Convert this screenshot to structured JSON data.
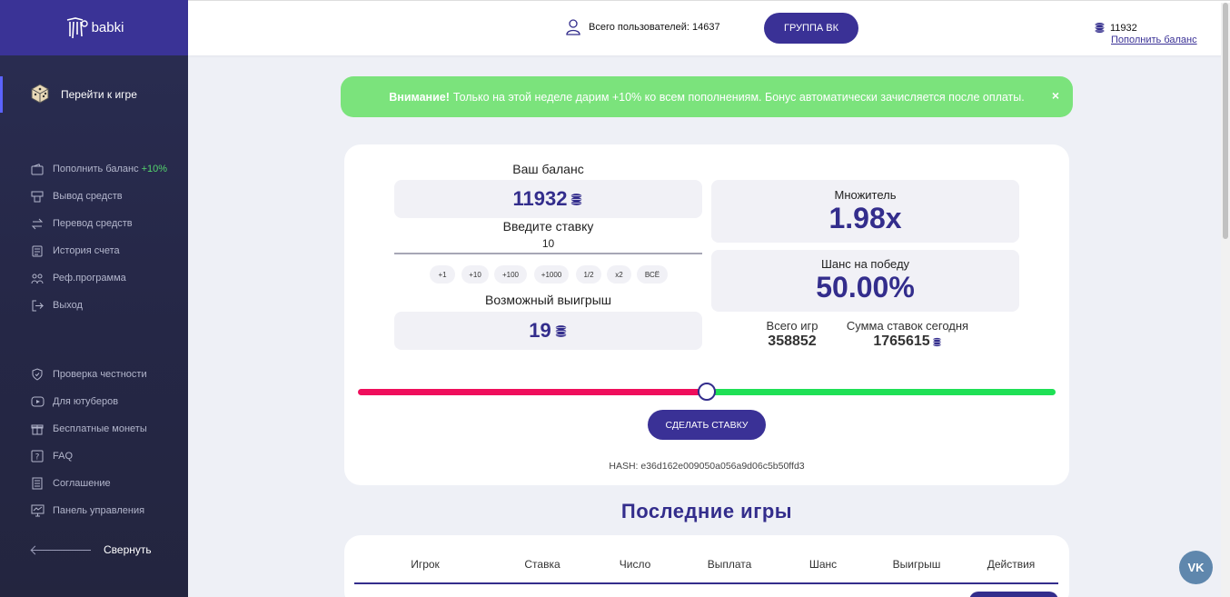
{
  "app": {
    "logo_text": "babki"
  },
  "sidebar": {
    "play_label": "Перейти к игре",
    "menu1": [
      {
        "label": "Пополнить баланс",
        "bonus": "+10%",
        "icon": "wallet-icon"
      },
      {
        "label": "Вывод средств",
        "icon": "atm-icon"
      },
      {
        "label": "Перевод средств",
        "icon": "transfer-icon"
      },
      {
        "label": "История счета",
        "icon": "history-icon"
      },
      {
        "label": "Реф.программа",
        "icon": "referral-icon"
      },
      {
        "label": "Выход",
        "icon": "logout-icon"
      }
    ],
    "menu2": [
      {
        "label": "Проверка честности",
        "icon": "shield-icon"
      },
      {
        "label": "Для ютуберов",
        "icon": "youtube-icon"
      },
      {
        "label": "Бесплатные монеты",
        "icon": "gift-icon"
      },
      {
        "label": "FAQ",
        "icon": "faq-icon"
      },
      {
        "label": "Соглашение",
        "icon": "document-icon"
      },
      {
        "label": "Панель управления",
        "icon": "dashboard-icon"
      }
    ],
    "collapse_label": "Свернуть"
  },
  "header": {
    "users_label": "Всего пользователей: 14637",
    "vk_group_label": "ГРУППА ВК",
    "balance": "11932",
    "topup_link": "Пополнить баланс"
  },
  "alert": {
    "strong": "Внимание!",
    "text": "Только на этой неделе дарим +10% ко всем пополнениям. Бонус автоматически зачисляется после оплаты.",
    "close": "×"
  },
  "game": {
    "balance_label": "Ваш баланс",
    "balance_value": "11932",
    "bet_label": "Введите ставку",
    "bet_value": "10",
    "quick": [
      "+1",
      "+10",
      "+100",
      "+1000",
      "1/2",
      "x2",
      "ВСЁ"
    ],
    "win_label": "Возможный выигрыш",
    "win_value": "19",
    "multiplier_label": "Множитель",
    "multiplier_value": "1.98x",
    "chance_label": "Шанс на победу",
    "chance_value": "50.00%",
    "chance_fraction": 0.5,
    "total_games_label": "Всего игр",
    "total_games_value": "358852",
    "bets_today_label": "Сумма ставок сегодня",
    "bets_today_value": "1765615",
    "make_bet_label": "СДЕЛАТЬ СТАВКУ",
    "hash": "HASH: e36d162e009050a056a9d06c5b50ffd3"
  },
  "last_games": {
    "title": "Последние игры",
    "columns": [
      "Игрок",
      "Ставка",
      "Число",
      "Выплата",
      "Шанс",
      "Выигрыш",
      "Действия"
    ]
  },
  "fab": {
    "label": "VK"
  },
  "colors": {
    "accent": "#3a3196",
    "sidebar": "#252746",
    "alert": "#7be37c",
    "lose": "#ef0e5c",
    "win": "#1fe055"
  }
}
